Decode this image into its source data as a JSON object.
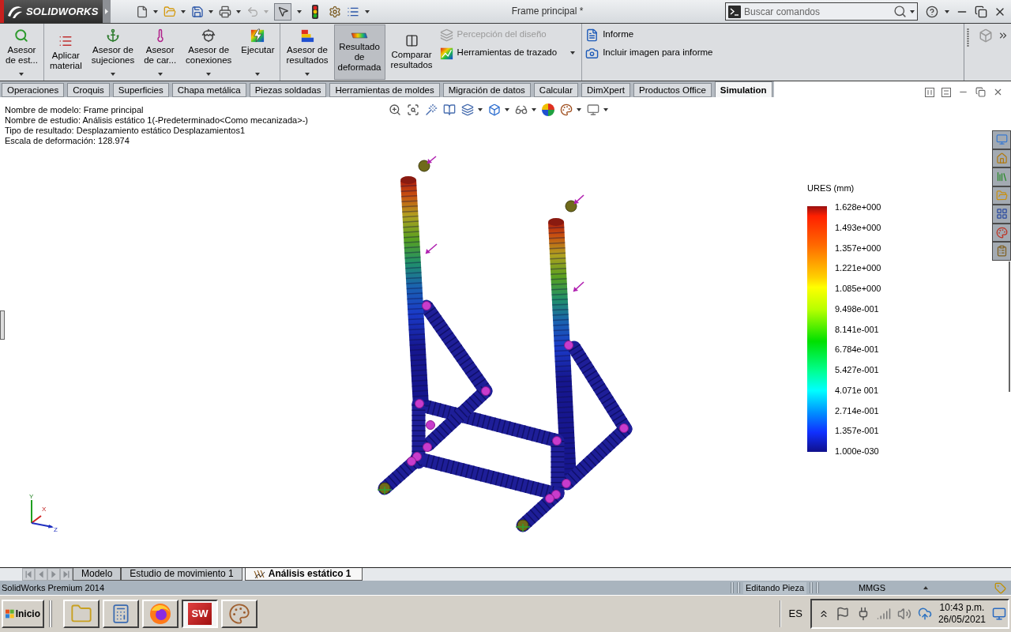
{
  "title_bar": {
    "logo": "SOLIDWORKS",
    "title": "Frame principal *",
    "search": {
      "placeholder": "Buscar comandos"
    }
  },
  "ribbon": {
    "groups": [
      {
        "large": [
          {
            "label": "Asesor\nde est...",
            "dropdown": true,
            "selected": false
          }
        ]
      },
      {
        "large": [
          {
            "label": "Aplicar\nmaterial",
            "dropdown": false,
            "selected": false
          },
          {
            "label": "Asesor de\nsujeciones",
            "dropdown": true,
            "selected": false
          },
          {
            "label": "Asesor\nde car...",
            "dropdown": true,
            "selected": false
          },
          {
            "label": "Asesor de\nconexiones",
            "dropdown": true,
            "selected": false
          },
          {
            "label": "Ejecutar",
            "dropdown": true,
            "selected": false
          }
        ]
      },
      {
        "large": [
          {
            "label": "Asesor de\nresultados",
            "dropdown": true,
            "selected": false
          },
          {
            "label": "Resultado\nde\ndeformada",
            "dropdown": false,
            "selected": true
          },
          {
            "label": "Comparar\nresultados",
            "dropdown": false,
            "selected": false
          }
        ],
        "small": [
          {
            "label": "Percepción del diseño",
            "dropdown": false,
            "disabled": true
          },
          {
            "label": "Herramientas de trazado",
            "dropdown": true,
            "disabled": false
          }
        ]
      },
      {
        "small": [
          {
            "label": "Informe",
            "dropdown": false,
            "disabled": false
          },
          {
            "label": "Incluir imagen para informe",
            "dropdown": false,
            "disabled": false
          }
        ]
      }
    ]
  },
  "tabs": [
    {
      "label": "Operaciones",
      "selected": false
    },
    {
      "label": "Croquis",
      "selected": false
    },
    {
      "label": "Superficies",
      "selected": false
    },
    {
      "label": "Chapa metálica",
      "selected": false
    },
    {
      "label": "Piezas soldadas",
      "selected": false
    },
    {
      "label": "Herramientas de moldes",
      "selected": false
    },
    {
      "label": "Migración de datos",
      "selected": false
    },
    {
      "label": "Calcular",
      "selected": false
    },
    {
      "label": "DimXpert",
      "selected": false
    },
    {
      "label": "Productos Office",
      "selected": false
    },
    {
      "label": "Simulation",
      "selected": true
    }
  ],
  "viewport": {
    "info": [
      "Nombre de modelo: Frame principal",
      "Nombre de estudio: Análisis estático 1(-Predeterminado<Como mecanizada>-)",
      "Tipo de resultado: Desplazamiento estático Desplazamientos1",
      "Escala de deformación: 128.974"
    ],
    "legend": {
      "title": "URES (mm)",
      "labels": [
        "1.628e+000",
        "1.493e+000",
        "1.357e+000",
        "1.221e+000",
        "1.085e+000",
        "9.498e-001",
        "8.141e-001",
        "6.784e-001",
        "5.427e-001",
        "4.071e 001",
        "2.714e-001",
        "1.357e-001",
        "1.000e-030"
      ]
    },
    "triad": {
      "axes": [
        "Y",
        "X",
        "Z"
      ]
    }
  },
  "bottom_tabs": [
    {
      "label": "Modelo",
      "kind": "model",
      "selected": false
    },
    {
      "label": "Estudio de movimiento 1",
      "kind": "motion",
      "selected": false
    },
    {
      "label": "Análisis estático 1",
      "kind": "static_study",
      "selected": true
    }
  ],
  "status_bar": {
    "product": "SolidWorks Premium 2014",
    "mode": "Editando Pieza",
    "units": "MMGS"
  },
  "taskbar": {
    "start": "Inicio",
    "apps": [
      {
        "selected": false
      },
      {
        "selected": false
      },
      {
        "selected": false
      },
      {
        "selected": true,
        "label": "SW"
      },
      {
        "selected": false
      }
    ],
    "language": "ES",
    "time": "10:43 p.m.",
    "date": "26/05/2021"
  }
}
